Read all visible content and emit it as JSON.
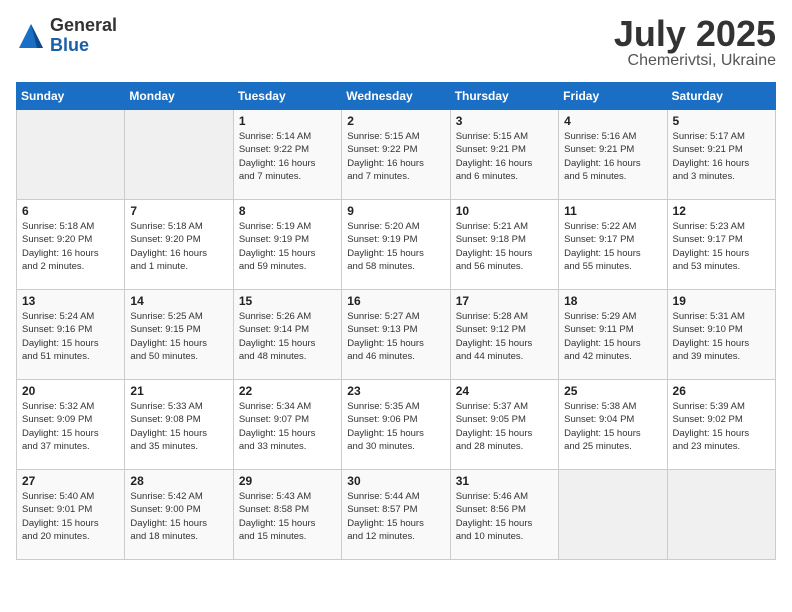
{
  "header": {
    "logo_general": "General",
    "logo_blue": "Blue",
    "month": "July 2025",
    "location": "Chemerivtsi, Ukraine"
  },
  "weekdays": [
    "Sunday",
    "Monday",
    "Tuesday",
    "Wednesday",
    "Thursday",
    "Friday",
    "Saturday"
  ],
  "weeks": [
    [
      {
        "day": "",
        "info": ""
      },
      {
        "day": "",
        "info": ""
      },
      {
        "day": "1",
        "info": "Sunrise: 5:14 AM\nSunset: 9:22 PM\nDaylight: 16 hours\nand 7 minutes."
      },
      {
        "day": "2",
        "info": "Sunrise: 5:15 AM\nSunset: 9:22 PM\nDaylight: 16 hours\nand 7 minutes."
      },
      {
        "day": "3",
        "info": "Sunrise: 5:15 AM\nSunset: 9:21 PM\nDaylight: 16 hours\nand 6 minutes."
      },
      {
        "day": "4",
        "info": "Sunrise: 5:16 AM\nSunset: 9:21 PM\nDaylight: 16 hours\nand 5 minutes."
      },
      {
        "day": "5",
        "info": "Sunrise: 5:17 AM\nSunset: 9:21 PM\nDaylight: 16 hours\nand 3 minutes."
      }
    ],
    [
      {
        "day": "6",
        "info": "Sunrise: 5:18 AM\nSunset: 9:20 PM\nDaylight: 16 hours\nand 2 minutes."
      },
      {
        "day": "7",
        "info": "Sunrise: 5:18 AM\nSunset: 9:20 PM\nDaylight: 16 hours\nand 1 minute."
      },
      {
        "day": "8",
        "info": "Sunrise: 5:19 AM\nSunset: 9:19 PM\nDaylight: 15 hours\nand 59 minutes."
      },
      {
        "day": "9",
        "info": "Sunrise: 5:20 AM\nSunset: 9:19 PM\nDaylight: 15 hours\nand 58 minutes."
      },
      {
        "day": "10",
        "info": "Sunrise: 5:21 AM\nSunset: 9:18 PM\nDaylight: 15 hours\nand 56 minutes."
      },
      {
        "day": "11",
        "info": "Sunrise: 5:22 AM\nSunset: 9:17 PM\nDaylight: 15 hours\nand 55 minutes."
      },
      {
        "day": "12",
        "info": "Sunrise: 5:23 AM\nSunset: 9:17 PM\nDaylight: 15 hours\nand 53 minutes."
      }
    ],
    [
      {
        "day": "13",
        "info": "Sunrise: 5:24 AM\nSunset: 9:16 PM\nDaylight: 15 hours\nand 51 minutes."
      },
      {
        "day": "14",
        "info": "Sunrise: 5:25 AM\nSunset: 9:15 PM\nDaylight: 15 hours\nand 50 minutes."
      },
      {
        "day": "15",
        "info": "Sunrise: 5:26 AM\nSunset: 9:14 PM\nDaylight: 15 hours\nand 48 minutes."
      },
      {
        "day": "16",
        "info": "Sunrise: 5:27 AM\nSunset: 9:13 PM\nDaylight: 15 hours\nand 46 minutes."
      },
      {
        "day": "17",
        "info": "Sunrise: 5:28 AM\nSunset: 9:12 PM\nDaylight: 15 hours\nand 44 minutes."
      },
      {
        "day": "18",
        "info": "Sunrise: 5:29 AM\nSunset: 9:11 PM\nDaylight: 15 hours\nand 42 minutes."
      },
      {
        "day": "19",
        "info": "Sunrise: 5:31 AM\nSunset: 9:10 PM\nDaylight: 15 hours\nand 39 minutes."
      }
    ],
    [
      {
        "day": "20",
        "info": "Sunrise: 5:32 AM\nSunset: 9:09 PM\nDaylight: 15 hours\nand 37 minutes."
      },
      {
        "day": "21",
        "info": "Sunrise: 5:33 AM\nSunset: 9:08 PM\nDaylight: 15 hours\nand 35 minutes."
      },
      {
        "day": "22",
        "info": "Sunrise: 5:34 AM\nSunset: 9:07 PM\nDaylight: 15 hours\nand 33 minutes."
      },
      {
        "day": "23",
        "info": "Sunrise: 5:35 AM\nSunset: 9:06 PM\nDaylight: 15 hours\nand 30 minutes."
      },
      {
        "day": "24",
        "info": "Sunrise: 5:37 AM\nSunset: 9:05 PM\nDaylight: 15 hours\nand 28 minutes."
      },
      {
        "day": "25",
        "info": "Sunrise: 5:38 AM\nSunset: 9:04 PM\nDaylight: 15 hours\nand 25 minutes."
      },
      {
        "day": "26",
        "info": "Sunrise: 5:39 AM\nSunset: 9:02 PM\nDaylight: 15 hours\nand 23 minutes."
      }
    ],
    [
      {
        "day": "27",
        "info": "Sunrise: 5:40 AM\nSunset: 9:01 PM\nDaylight: 15 hours\nand 20 minutes."
      },
      {
        "day": "28",
        "info": "Sunrise: 5:42 AM\nSunset: 9:00 PM\nDaylight: 15 hours\nand 18 minutes."
      },
      {
        "day": "29",
        "info": "Sunrise: 5:43 AM\nSunset: 8:58 PM\nDaylight: 15 hours\nand 15 minutes."
      },
      {
        "day": "30",
        "info": "Sunrise: 5:44 AM\nSunset: 8:57 PM\nDaylight: 15 hours\nand 12 minutes."
      },
      {
        "day": "31",
        "info": "Sunrise: 5:46 AM\nSunset: 8:56 PM\nDaylight: 15 hours\nand 10 minutes."
      },
      {
        "day": "",
        "info": ""
      },
      {
        "day": "",
        "info": ""
      }
    ]
  ]
}
